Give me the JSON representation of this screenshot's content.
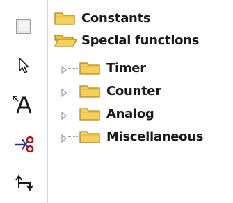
{
  "toolbar": {
    "tools": [
      {
        "name": "selection-box-tool",
        "icon": "square-outline-icon"
      },
      {
        "name": "pointer-tool",
        "icon": "arrow-pointer-icon"
      },
      {
        "name": "text-tool",
        "icon": "text-a-icon"
      },
      {
        "name": "cut-connection-tool",
        "icon": "scissors-icon"
      },
      {
        "name": "connect-tool",
        "icon": "connector-arrows-icon"
      }
    ]
  },
  "tree": {
    "items": [
      {
        "label": "Constants",
        "level": 0,
        "icon": "folder-icon"
      },
      {
        "label": "Special functions",
        "level": 0,
        "icon": "folder-open-icon"
      },
      {
        "label": "Timer",
        "level": 1,
        "icon": "folder-icon",
        "expandable": true
      },
      {
        "label": "Counter",
        "level": 1,
        "icon": "folder-icon",
        "expandable": true
      },
      {
        "label": "Analog",
        "level": 1,
        "icon": "folder-icon",
        "expandable": true
      },
      {
        "label": "Miscellaneous",
        "level": 1,
        "icon": "folder-icon",
        "expandable": true
      }
    ]
  },
  "colors": {
    "folder_fill": "#f4cf5a",
    "folder_edge": "#b08a1e",
    "tool_blue": "#2a2a8a",
    "tool_red": "#b01515"
  }
}
